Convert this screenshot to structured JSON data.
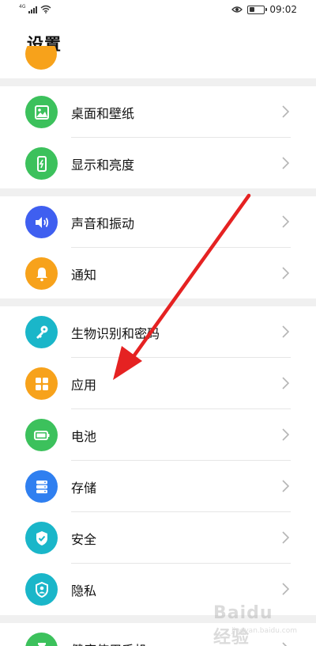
{
  "status_bar": {
    "signal_label": "4G",
    "time": "09:02",
    "battery_level": 0.35
  },
  "page_title": "设置",
  "groups": [
    {
      "items": [
        {
          "label": "桌面和壁纸",
          "icon": "wallpaper-icon",
          "color": "#3cc15c"
        },
        {
          "label": "显示和亮度",
          "icon": "phone-brightness-icon",
          "color": "#3cc15c"
        }
      ]
    },
    {
      "items": [
        {
          "label": "声音和振动",
          "icon": "speaker-icon",
          "color": "#3f5ff0"
        },
        {
          "label": "通知",
          "icon": "bell-icon",
          "color": "#f7a21b"
        }
      ]
    },
    {
      "items": [
        {
          "label": "生物识别和密码",
          "icon": "key-icon",
          "color": "#1ab6c9"
        },
        {
          "label": "应用",
          "icon": "apps-grid-icon",
          "color": "#f7a21b"
        },
        {
          "label": "电池",
          "icon": "battery-icon",
          "color": "#3cc15c"
        },
        {
          "label": "存储",
          "icon": "storage-icon",
          "color": "#2f7ff0"
        },
        {
          "label": "安全",
          "icon": "shield-check-icon",
          "color": "#1ab6c9"
        },
        {
          "label": "隐私",
          "icon": "privacy-shield-icon",
          "color": "#1ab6c9"
        }
      ]
    },
    {
      "items": [
        {
          "label": "健康使用手机",
          "icon": "hourglass-icon",
          "color": "#3cc15c"
        }
      ]
    }
  ],
  "watermark": {
    "line1": "Baidu 经验",
    "line2": "jingyan.baidu.com"
  },
  "annotation": {
    "arrow_color": "#e52222"
  }
}
